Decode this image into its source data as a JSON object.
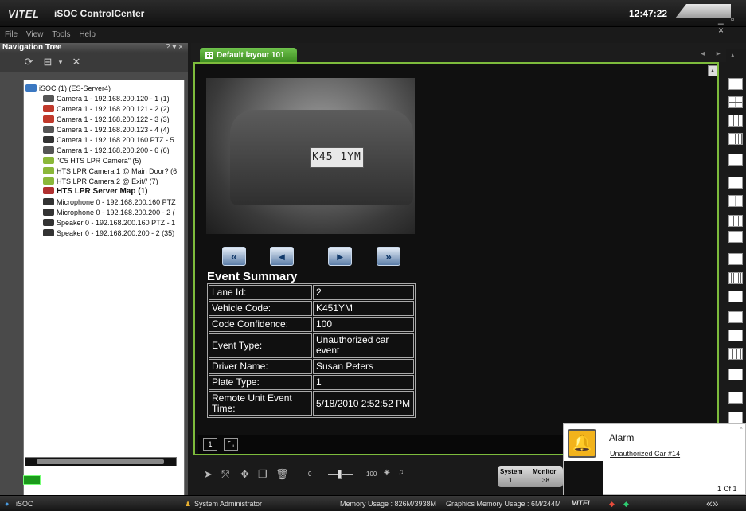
{
  "app": {
    "logo": "VITEL",
    "title": "iSOC ControlCenter",
    "clock": "12:47:22",
    "window_controls": "_ ▫ ×"
  },
  "menu": [
    "File",
    "View",
    "Tools",
    "Help"
  ],
  "nav": {
    "title": "Navigation Tree",
    "header_controls": "? ▾ ×",
    "tree": [
      {
        "label": "iSOC (1) (ES-Server4)",
        "icon": "server-icon",
        "color": "#3a78c2",
        "bold": false,
        "indent": 0
      },
      {
        "label": "Camera 1 - 192.168.200.120 - 1 (1)",
        "icon": "camera-icon",
        "color": "#555555",
        "bold": false,
        "indent": 1
      },
      {
        "label": "Camera 1 - 192.168.200.121 - 2 (2)",
        "icon": "camera-alert-icon",
        "color": "#c0392b",
        "bold": false,
        "indent": 1
      },
      {
        "label": "Camera 1 - 192.168.200.122 - 3 (3)",
        "icon": "camera-alert-icon",
        "color": "#c0392b",
        "bold": false,
        "indent": 1
      },
      {
        "label": "Camera 1 - 192.168.200.123 - 4 (4)",
        "icon": "camera-icon",
        "color": "#555555",
        "bold": false,
        "indent": 1
      },
      {
        "label": "Camera 1 - 192.168.200.160 PTZ - 5",
        "icon": "ptz-camera-icon",
        "color": "#333333",
        "bold": false,
        "indent": 1
      },
      {
        "label": "Camera 1 - 192.168.200.200 - 6 (6)",
        "icon": "camera-icon",
        "color": "#555555",
        "bold": false,
        "indent": 1
      },
      {
        "label": "\"C5 HTS LPR Camera\" (5)",
        "icon": "lpr-icon",
        "color": "#8bb83a",
        "bold": false,
        "indent": 1
      },
      {
        "label": "HTS LPR Camera 1 @ Main Door? (6",
        "icon": "lpr-icon",
        "color": "#8bb83a",
        "bold": false,
        "indent": 1
      },
      {
        "label": "HTS LPR Camera 2 @ Exit// (7)",
        "icon": "lpr-icon",
        "color": "#8bb83a",
        "bold": false,
        "indent": 1
      },
      {
        "label": "HTS LPR Server Map (1)",
        "icon": "map-icon",
        "color": "#b03030",
        "bold": true,
        "indent": 1
      },
      {
        "label": "Microphone 0 - 192.168.200.160 PTZ",
        "icon": "microphone-icon",
        "color": "#333333",
        "bold": false,
        "indent": 1
      },
      {
        "label": "Microphone 0 - 192.168.200.200 - 2 (",
        "icon": "microphone-icon",
        "color": "#333333",
        "bold": false,
        "indent": 1
      },
      {
        "label": "Speaker 0 - 192.168.200.160 PTZ - 1",
        "icon": "speaker-icon",
        "color": "#333333",
        "bold": false,
        "indent": 1
      },
      {
        "label": "Speaker 0 - 192.168.200.200 - 2 (35)",
        "icon": "speaker-icon",
        "color": "#333333",
        "bold": false,
        "indent": 1
      }
    ]
  },
  "layout_tab": {
    "label": "Default layout 101",
    "nav_arrows": "◂ ▸ ×"
  },
  "viewer": {
    "plate_text": "K45  1YM",
    "nav_buttons": [
      {
        "name": "first-event-button",
        "label": "«"
      },
      {
        "name": "prev-event-button",
        "label": "◂"
      },
      {
        "name": "next-event-button",
        "label": "▸"
      },
      {
        "name": "last-event-button",
        "label": "»"
      }
    ],
    "event_summary_title": "Event Summary",
    "event_rows": [
      {
        "key": "Lane Id:",
        "value": "2"
      },
      {
        "key": "Vehicle Code:",
        "value": "K451YM"
      },
      {
        "key": "Code Confidence:",
        "value": "100"
      },
      {
        "key": "Event Type:",
        "value": "Unauthorized car event"
      },
      {
        "key": "Driver Name:",
        "value": "Susan Peters"
      },
      {
        "key": "Plate Type:",
        "value": "1"
      },
      {
        "key": "Remote Unit Event Time:",
        "value": "5/18/2010 2:52:52 PM"
      }
    ],
    "page_number": "1"
  },
  "toolbar": {
    "volume_min": "0",
    "volume_max": "100",
    "system_label": "System",
    "system_value": "1",
    "monitor_label": "Monitor",
    "monitor_value": "38"
  },
  "alarm": {
    "title": "Alarm",
    "link": "Unauthorized Car #14",
    "page": "1 Of 1",
    "close": "×"
  },
  "status": {
    "root": "iSOC",
    "user": "System Administrator",
    "memory": "Memory Usage : 826M/3938M",
    "graphics": "Graphics Memory Usage : 6M/244M",
    "logo": "VITEL"
  }
}
